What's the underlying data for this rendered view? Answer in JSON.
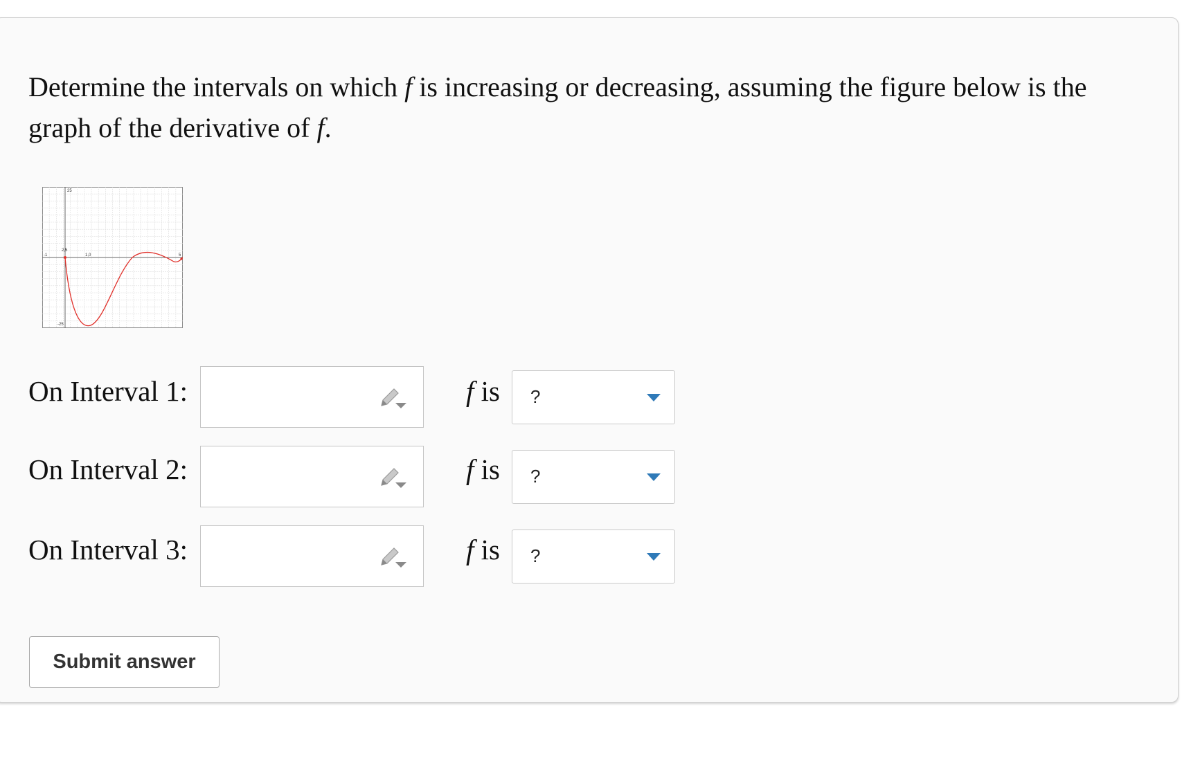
{
  "question": {
    "text_before_f1": "Determine the intervals on which ",
    "f_symbol": "f",
    "text_between": " is increasing or decreasing, assuming the figure below is the graph of the derivative of ",
    "text_end": "."
  },
  "graph": {
    "tick_labels": {
      "y_top": "25",
      "y_bottom": "-25",
      "x_left": "-1",
      "x_right": "5",
      "point_a": "2,5",
      "point_b": "1,0"
    },
    "curve_color": "#e0302a",
    "axis_color": "#666666",
    "grid_color": "#dddddd"
  },
  "rows": [
    {
      "label": "On Interval 1:",
      "answer_value": "",
      "f_is": "f is",
      "select_value": "?"
    },
    {
      "label": "On Interval 2:",
      "answer_value": "",
      "f_is": "f is",
      "select_value": "?"
    },
    {
      "label": "On Interval 3:",
      "answer_value": "",
      "f_is": "f is",
      "select_value": "?"
    }
  ],
  "submit_label": "Submit answer",
  "icons": {
    "answer_tool": "pencil-dropdown-icon",
    "select_caret": "caret-down-icon"
  },
  "accent_color": "#2f7ab8"
}
